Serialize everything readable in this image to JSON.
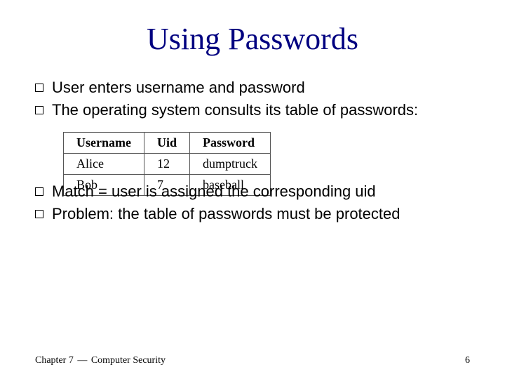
{
  "title": "Using Passwords",
  "bullets_top": [
    "User enters username and password",
    "The operating system consults its table of passwords:"
  ],
  "bullets_bottom": [
    "Match = user is assigned the corresponding uid",
    "Problem: the table of passwords must be protected"
  ],
  "table": {
    "headers": [
      "Username",
      "Uid",
      "Password"
    ],
    "rows": [
      [
        "Alice",
        "12",
        "dumptruck"
      ],
      [
        "Bob",
        "7",
        "baseball"
      ]
    ]
  },
  "footer": {
    "chapter": "Chapter 7",
    "dash": "—",
    "topic": "Computer Security",
    "page": "6"
  }
}
